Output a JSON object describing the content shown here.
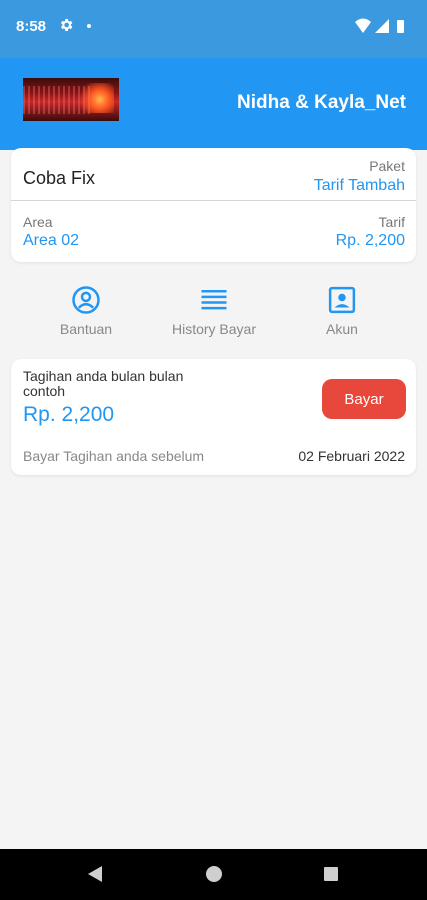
{
  "status_bar": {
    "time": "8:58"
  },
  "app_bar": {
    "title": "Nidha & Kayla_Net"
  },
  "customer": {
    "name": "Coba Fix",
    "paket_label": "Paket",
    "paket_value": "Tarif Tambah",
    "area_label": "Area",
    "area_value": "Area 02",
    "tarif_label": "Tarif",
    "tarif_value": "Rp. 2,200"
  },
  "menu": {
    "items": [
      {
        "label": "Bantuan",
        "icon": "account-circle-icon"
      },
      {
        "label": "History Bayar",
        "icon": "list-icon"
      },
      {
        "label": "Akun",
        "icon": "account-box-icon"
      }
    ]
  },
  "bill": {
    "description": "Tagihan anda bulan bulan contoh",
    "amount": "Rp. 2,200",
    "pay_label": "Bayar",
    "due_label": "Bayar Tagihan anda sebelum",
    "due_date": "02 Februari 2022"
  },
  "colors": {
    "primary": "#2196f3",
    "status_bar": "#3b99e0",
    "pay_button": "#e8483b"
  }
}
